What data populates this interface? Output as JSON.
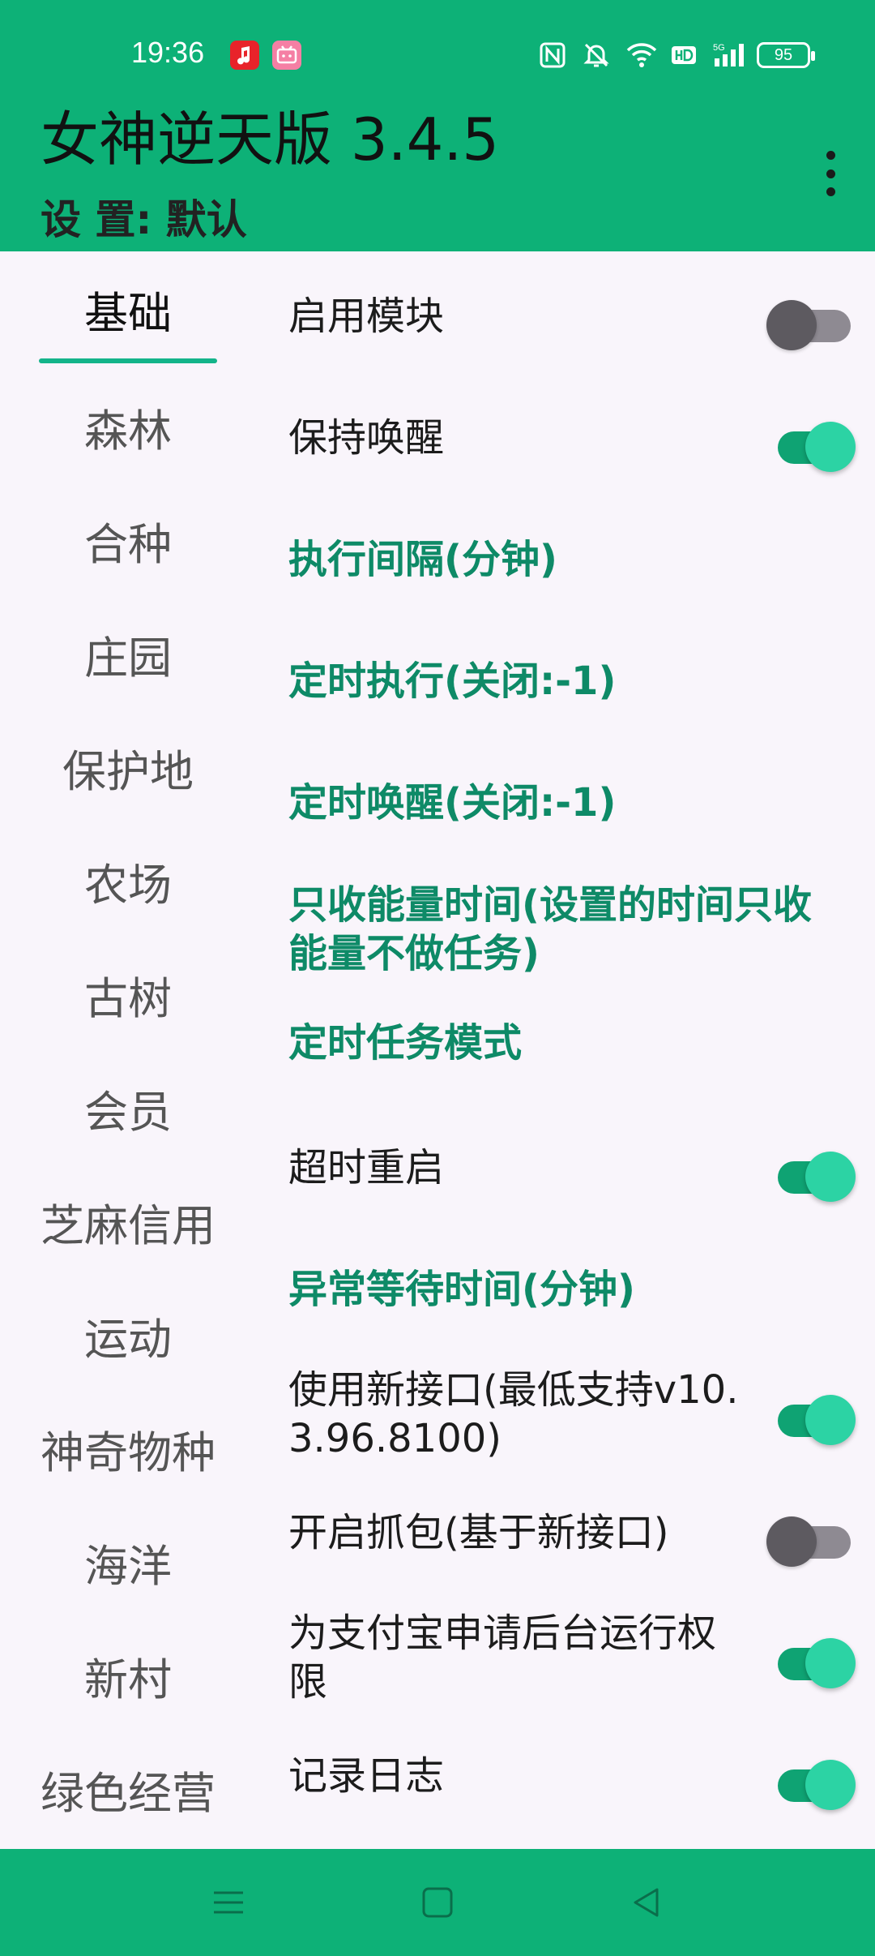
{
  "status_bar": {
    "time": "19:36",
    "notification_icons": [
      "music-app-icon",
      "bilibili-app-icon"
    ],
    "right_icons": [
      "nfc-icon",
      "mute-icon",
      "wifi-icon",
      "hd-icon",
      "5g-signal-icon"
    ],
    "battery": "95"
  },
  "app_bar": {
    "title": "女神逆天版 3.4.5",
    "subtitle": "设 置: 默认",
    "menu_icon": "more-vert-icon"
  },
  "sidebar": {
    "items": [
      {
        "label": "基础",
        "active": true
      },
      {
        "label": "森林"
      },
      {
        "label": "合种"
      },
      {
        "label": "庄园"
      },
      {
        "label": "保护地"
      },
      {
        "label": "农场"
      },
      {
        "label": "古树"
      },
      {
        "label": "会员"
      },
      {
        "label": "芝麻信用"
      },
      {
        "label": "运动"
      },
      {
        "label": "神奇物种"
      },
      {
        "label": "海洋"
      },
      {
        "label": "新村"
      },
      {
        "label": "绿色经营"
      }
    ]
  },
  "settings": [
    {
      "label": "启用模块",
      "type": "switch",
      "on": false
    },
    {
      "label": "保持唤醒",
      "type": "switch",
      "on": true
    },
    {
      "label": "执行间隔(分钟)",
      "type": "link"
    },
    {
      "label": "定时执行(关闭:-1)",
      "type": "link"
    },
    {
      "label": "定时唤醒(关闭:-1)",
      "type": "link"
    },
    {
      "label": "只收能量时间(设置的时间只收能量不做任务)",
      "type": "link"
    },
    {
      "label": "定时任务模式",
      "type": "link"
    },
    {
      "label": "超时重启",
      "type": "switch",
      "on": true
    },
    {
      "label": "异常等待时间(分钟)",
      "type": "link"
    },
    {
      "label": "使用新接口(最低支持v10.3.96.8100)",
      "type": "switch",
      "on": true
    },
    {
      "label": "开启抓包(基于新接口)",
      "type": "switch",
      "on": false
    },
    {
      "label": "为支付宝申请后台运行权限",
      "type": "switch",
      "on": true
    },
    {
      "label": "记录日志",
      "type": "switch",
      "on": true
    }
  ],
  "nav_bar": {
    "icons": [
      "recent-apps-icon",
      "home-icon",
      "back-icon"
    ]
  },
  "colors": {
    "primary": "#0db177",
    "accent_text": "#0e8a67",
    "switch_on": "#2cd3a4",
    "switch_off": "#5d5a60",
    "background": "#f9f5fb"
  }
}
